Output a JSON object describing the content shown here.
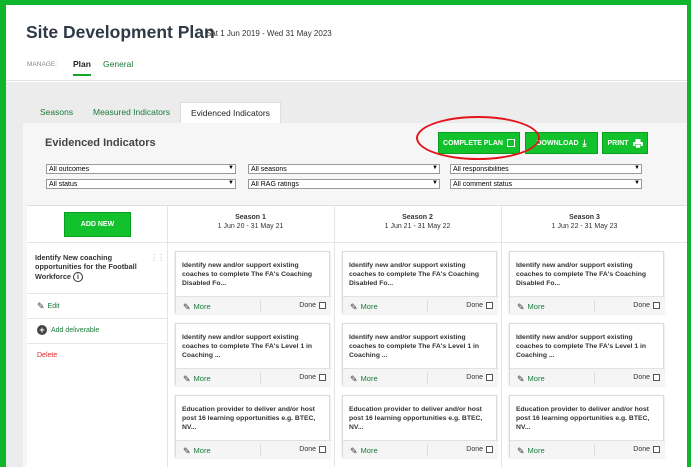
{
  "header": {
    "title": "Site Development Plan",
    "date_range": "Sat 1 Jun 2019 - Wed 31 May 2023",
    "manage_label": "MANAGE:",
    "tabs": [
      {
        "label": "Plan",
        "active": true
      },
      {
        "label": "General",
        "active": false
      }
    ]
  },
  "section_tabs": [
    {
      "label": "Seasons",
      "active": false
    },
    {
      "label": "Measured Indicators",
      "active": false
    },
    {
      "label": "Evidenced Indicators",
      "active": true
    }
  ],
  "panel": {
    "title": "Evidenced Indicators",
    "buttons": {
      "complete_plan": "COMPLETE PLAN",
      "download": "DOWNLOAD",
      "print": "PRINT"
    }
  },
  "filters": [
    {
      "value": "All outcomes"
    },
    {
      "value": "All seasons"
    },
    {
      "value": "All responsibilities"
    },
    {
      "value": "All status"
    },
    {
      "value": "All RAG ratings"
    },
    {
      "value": "All comment status"
    }
  ],
  "grid": {
    "add_new_label": "ADD NEW",
    "seasons": [
      {
        "title": "Season 1",
        "dates": "1 Jun 20 - 31 May 21"
      },
      {
        "title": "Season 2",
        "dates": "1 Jun 21 - 31 May 22"
      },
      {
        "title": "Season 3",
        "dates": "1 Jun 22 - 31 May 23"
      }
    ],
    "objective": {
      "title": "Identify New coaching opportunities for the Football Workforce",
      "info_icon": "i",
      "edit_label": "Edit",
      "add_deliverable_label": "Add deliverable",
      "delete_label": "Delete"
    },
    "deliverables": [
      "Identify new and/or support existing coaches to complete The FA's Coaching Disabled Fo...",
      "Identify new and/or support existing coaches to complete The FA's Level 1 in Coaching ...",
      "Education provider to deliver and/or host post 16 learning opportunities e.g. BTEC, NV..."
    ],
    "card_more_label": "More",
    "card_done_label": "Done"
  },
  "colors": {
    "accent": "#12c22c",
    "highlight_ring": "#e3151b",
    "link": "#197a3a",
    "delete": "#d9262b"
  },
  "icons": [
    "checkbox-icon",
    "download-icon",
    "printer-icon",
    "info-icon",
    "pencil-icon",
    "plus-circle-icon",
    "drag-handle-icon",
    "chevron-down-icon"
  ]
}
